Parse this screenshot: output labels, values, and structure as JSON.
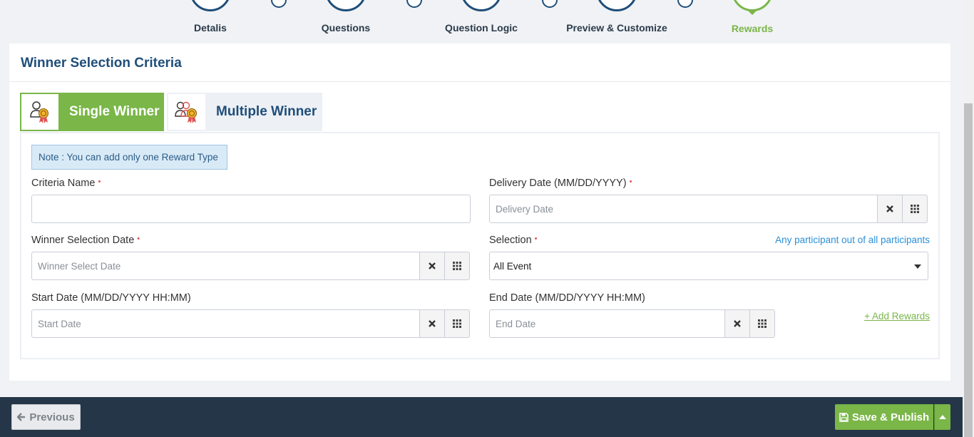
{
  "stepper": {
    "steps": [
      {
        "label": "Detalis"
      },
      {
        "label": "Questions"
      },
      {
        "label": "Question Logic"
      },
      {
        "label": "Preview & Customize"
      },
      {
        "label": "Rewards",
        "active": true
      }
    ]
  },
  "card": {
    "title": "Winner Selection Criteria",
    "tabs": {
      "single": {
        "label": "Single Winner",
        "icon": "winner-medal-icon"
      },
      "multiple": {
        "label": "Multiple Winner",
        "icon": "group-winner-medal-icon"
      }
    },
    "note": "Note : You can add only one Reward Type",
    "form": {
      "criteria_name": {
        "label": "Criteria Name",
        "value": "",
        "placeholder": ""
      },
      "delivery_date": {
        "label": "Delivery Date (MM/DD/YYYY)",
        "placeholder": "Delivery Date"
      },
      "winner_selection_date": {
        "label": "Winner Selection Date",
        "placeholder": "Winner Select Date"
      },
      "selection": {
        "label": "Selection",
        "value": "All Event",
        "hint_link": "Any participant out of all participants"
      },
      "start_date": {
        "label": "Start Date (MM/DD/YYYY HH:MM)",
        "placeholder": "Start Date"
      },
      "end_date": {
        "label": "End Date (MM/DD/YYYY HH:MM)",
        "placeholder": "End Date"
      },
      "add_rewards": "+ Add Rewards"
    }
  },
  "footer": {
    "previous_label": "Previous",
    "save_label": "Save & Publish"
  },
  "colors": {
    "primary": "#1f4e79",
    "accent_green": "#7ab648",
    "footer_bg": "#253648",
    "link_blue": "#2a8fd8"
  }
}
